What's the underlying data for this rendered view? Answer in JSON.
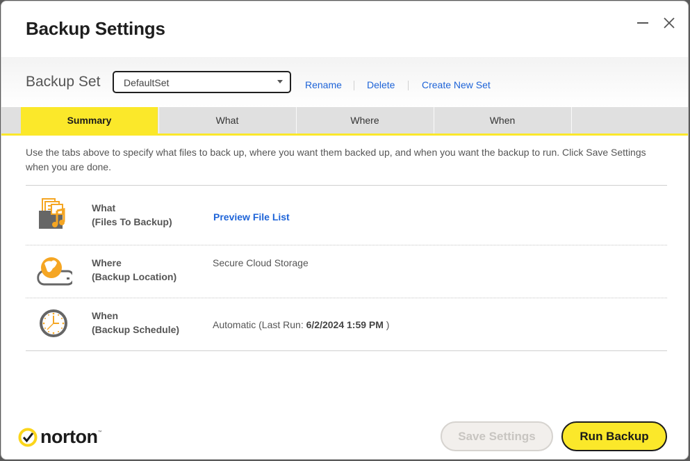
{
  "window": {
    "title": "Backup Settings",
    "minimize_icon": "minimize-icon",
    "close_icon": "close-icon"
  },
  "backup_set": {
    "label": "Backup Set",
    "selected": "DefaultSet",
    "links": [
      "Rename",
      "Delete",
      "Create New Set"
    ]
  },
  "tabs": [
    {
      "label": "Summary",
      "active": true
    },
    {
      "label": "What",
      "active": false
    },
    {
      "label": "Where",
      "active": false
    },
    {
      "label": "When",
      "active": false
    }
  ],
  "intro": "Use the tabs above to specify what files to back up, where you want them backed up, and when you want the backup to run. Click Save Settings when you are done.",
  "summary": {
    "what": {
      "icon": "files-folder-icon",
      "title": "What",
      "subtitle": "(Files To Backup)",
      "link": "Preview File List"
    },
    "where": {
      "icon": "cloud-drive-icon",
      "title": "Where",
      "subtitle": "(Backup Location)",
      "value": "Secure Cloud Storage"
    },
    "when": {
      "icon": "clock-icon",
      "title": "When",
      "subtitle": "(Backup Schedule)",
      "value_prefix": "Automatic (Last Run: ",
      "last_run": "6/2/2024 1:59 PM",
      "value_suffix": " )"
    }
  },
  "footer": {
    "brand": "norton",
    "brand_tm": "™",
    "save_label": "Save Settings",
    "save_enabled": false,
    "run_label": "Run Backup"
  },
  "colors": {
    "accent": "#fbe82a",
    "link": "#1e64d8",
    "icon_orange": "#f5a623",
    "icon_gray": "#6a6a6a"
  }
}
